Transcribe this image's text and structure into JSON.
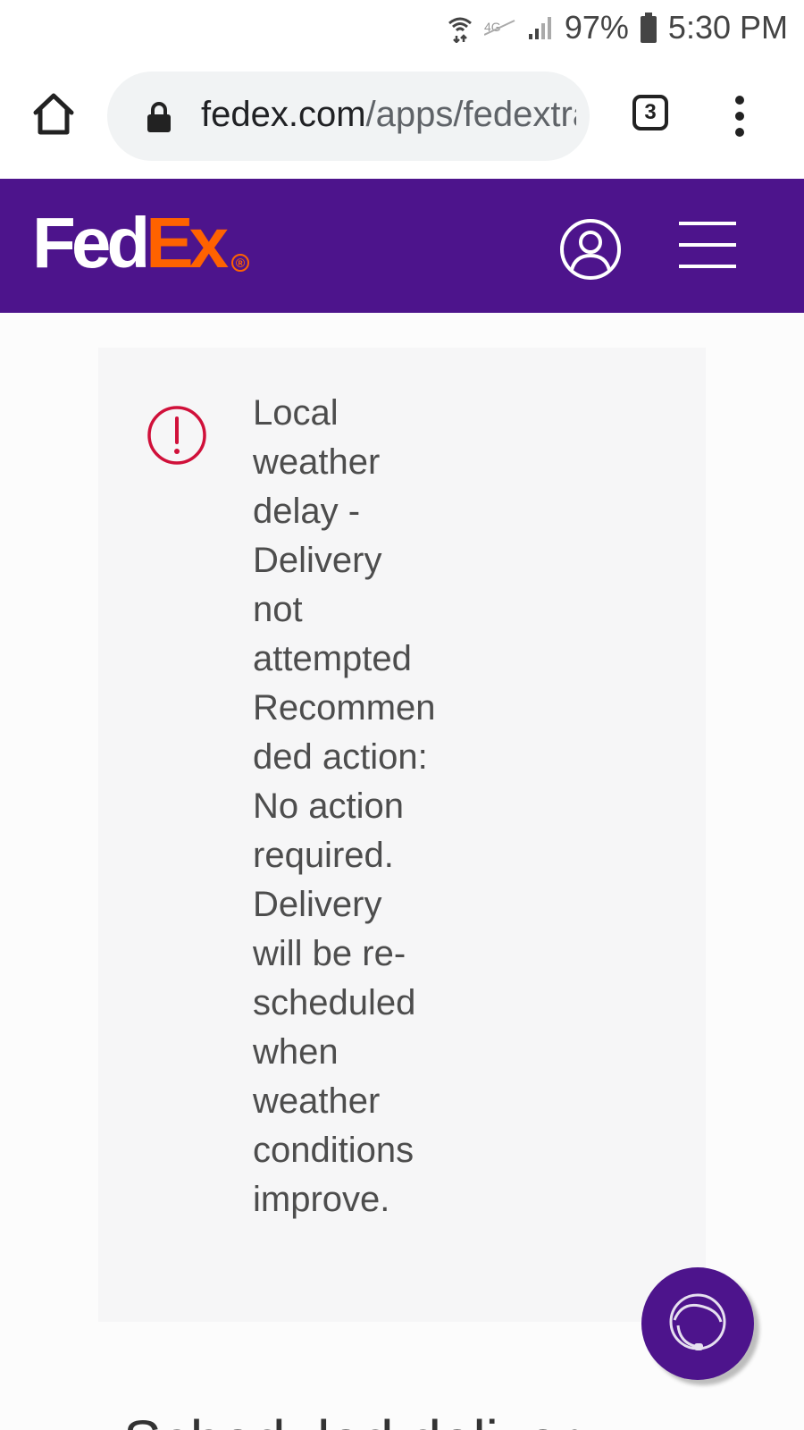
{
  "status_bar": {
    "battery": "97%",
    "time": "5:30 PM"
  },
  "browser": {
    "url_domain": "fedex.com",
    "url_path": "/apps/fedextrack",
    "tab_count": "3"
  },
  "header": {
    "logo_fed": "Fed",
    "logo_ex": "Ex",
    "logo_registered": "®",
    "brand_purple": "#4d148c",
    "brand_orange": "#ff6200"
  },
  "alert": {
    "icon": "alert-circle-icon",
    "icon_color": "#d0103a",
    "message": "Local weather delay - Delivery not attempted Recommended action: No action required. Delivery will be re-scheduled when weather conditions improve."
  },
  "chat": {
    "icon": "chat-agent-icon"
  },
  "next_section": {
    "heading": "Scheduled delivery"
  }
}
